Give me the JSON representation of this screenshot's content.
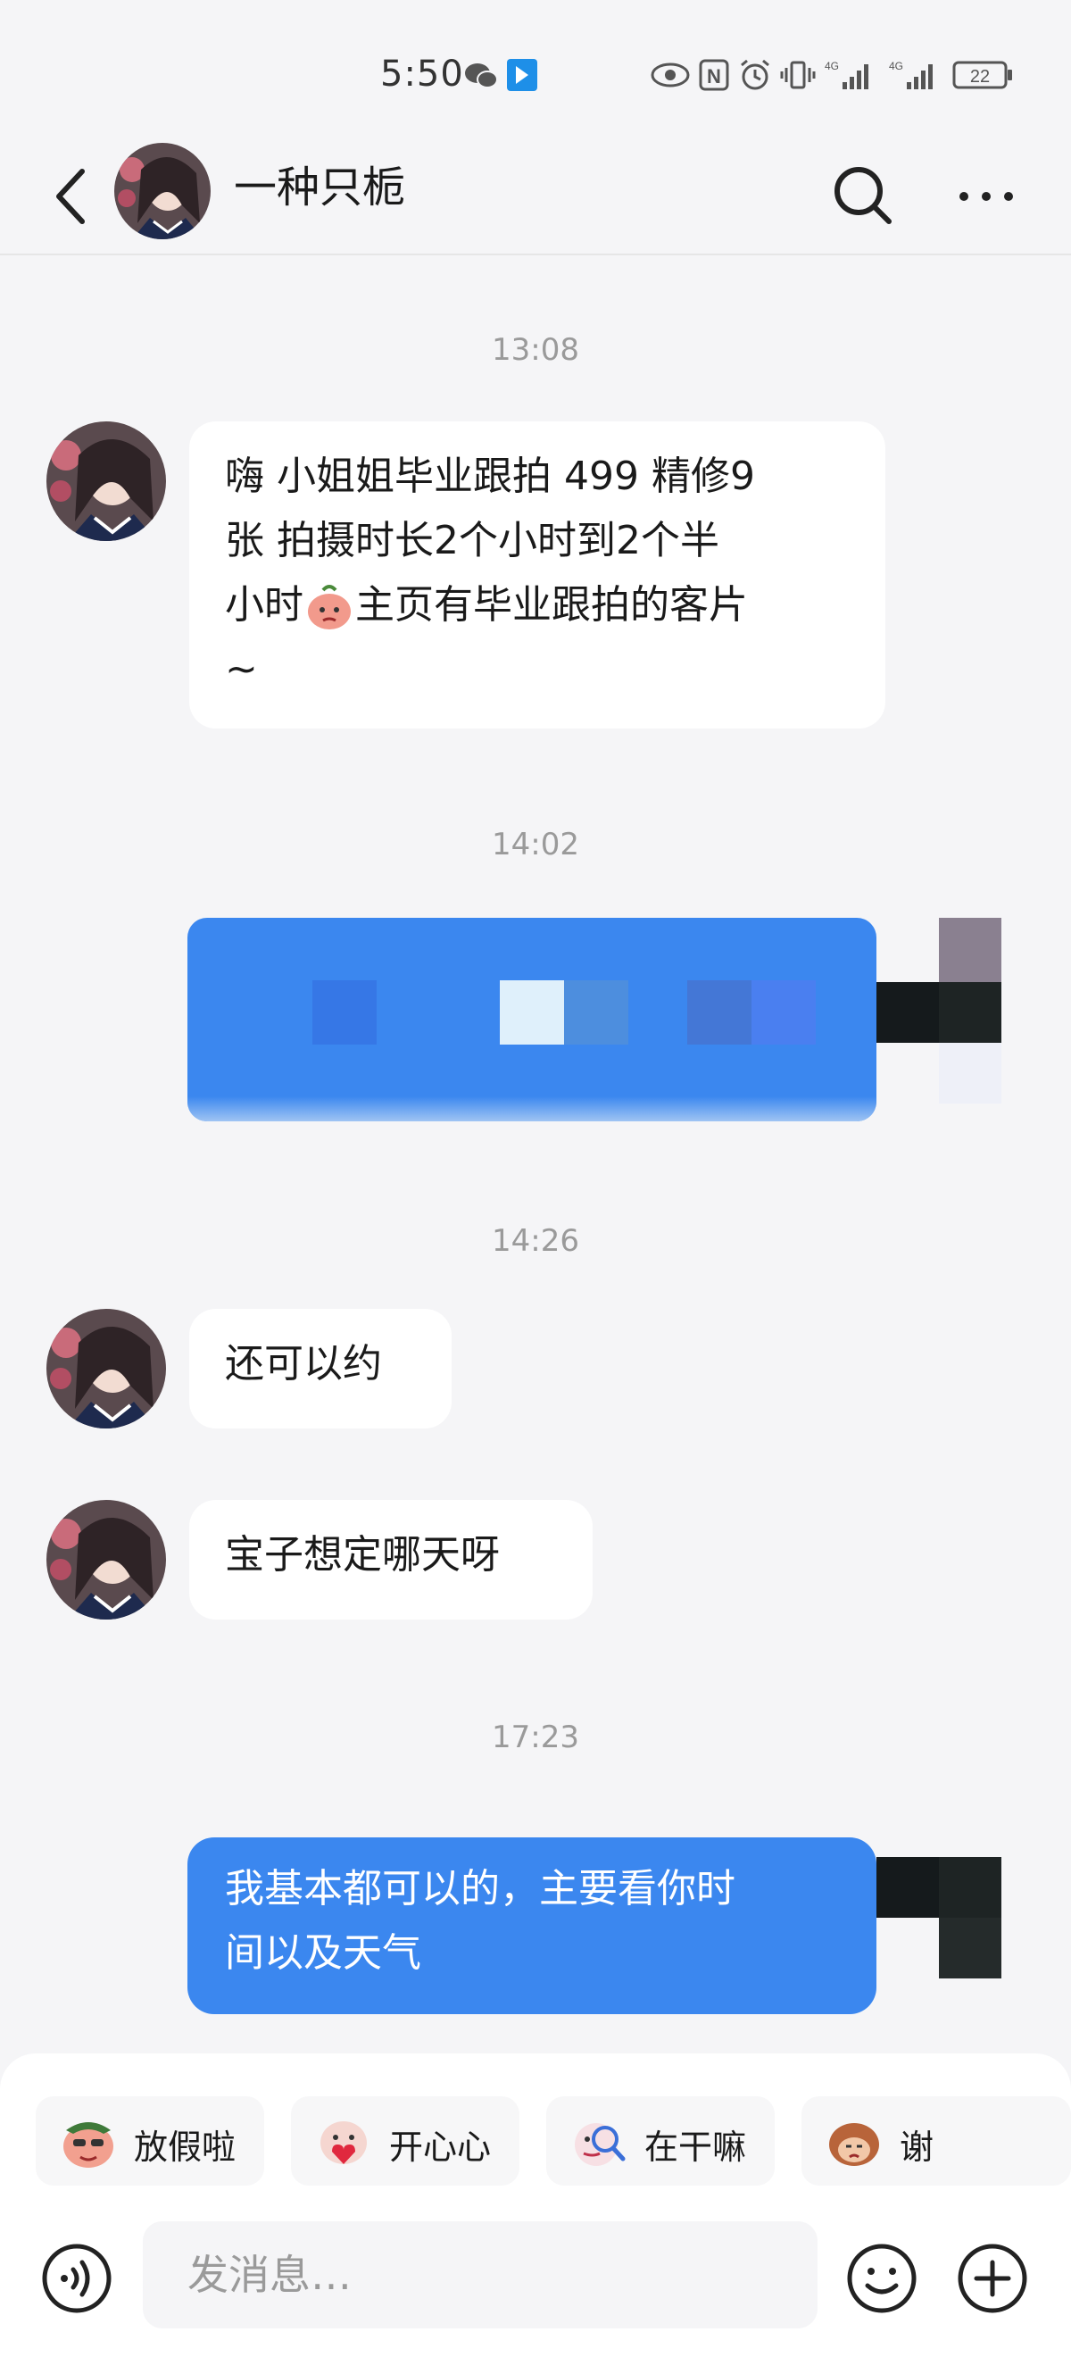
{
  "status_bar": {
    "time": "5:50",
    "network_1": "4G",
    "network_2": "4G",
    "battery": "22"
  },
  "header": {
    "title": "一种只栀",
    "back_icon": "chevron-left-icon",
    "search_icon": "search-icon",
    "more_icon": "more-icon"
  },
  "messages": {
    "ts1": "13:08",
    "m1": {
      "sender": "other",
      "line1": "嗨 小姐姐毕业跟拍 499 精修9",
      "line2": "张 拍摄时长2个小时到2个半",
      "line3a": "小时",
      "line3b": "主页有毕业跟拍的客片",
      "line4": "~"
    },
    "ts2": "14:02",
    "m2": {
      "sender": "me",
      "content": "pixelated"
    },
    "ts3": "14:26",
    "m3": {
      "sender": "other",
      "text": "还可以约"
    },
    "m4": {
      "sender": "other",
      "text": "宝子想定哪天呀"
    },
    "ts4": "17:23",
    "m5": {
      "sender": "me",
      "line1": "我基本都可以的，主要看你时",
      "line2": "间以及天气"
    }
  },
  "quick_replies": [
    {
      "label": "放假啦"
    },
    {
      "label": "开心心"
    },
    {
      "label": "在干嘛"
    },
    {
      "label": "谢"
    }
  ],
  "input": {
    "placeholder": "发消息…"
  },
  "colors": {
    "accent": "#3b87ef",
    "background": "#f5f5f7",
    "bubble_in": "#ffffff"
  }
}
